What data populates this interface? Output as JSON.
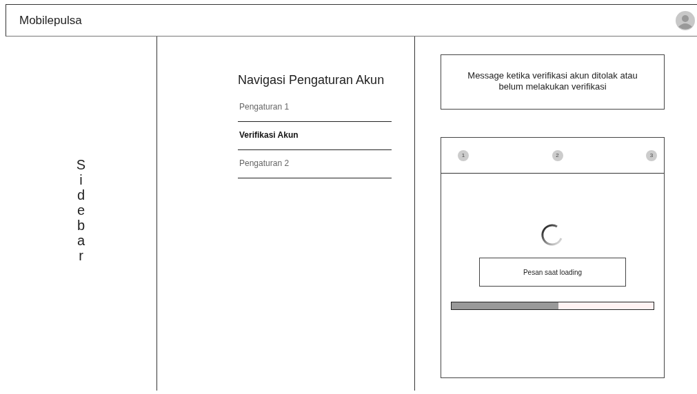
{
  "header": {
    "title": "Mobilepulsa"
  },
  "sidebar": {
    "label": "Sidebar"
  },
  "settings_nav": {
    "title": "Navigasi Pengaturan Akun",
    "items": [
      {
        "label": "Pengaturan 1",
        "selected": false
      },
      {
        "label": "Verifikasi Akun",
        "selected": true
      },
      {
        "label": "Pengaturan 2",
        "selected": false
      }
    ]
  },
  "message": "Message ketika verifikasi akun ditolak atau belum melakukan verifikasi",
  "stepper": {
    "steps": [
      "1",
      "2",
      "3"
    ]
  },
  "loading": {
    "message": "Pesan saat loading",
    "level": 0.53
  }
}
